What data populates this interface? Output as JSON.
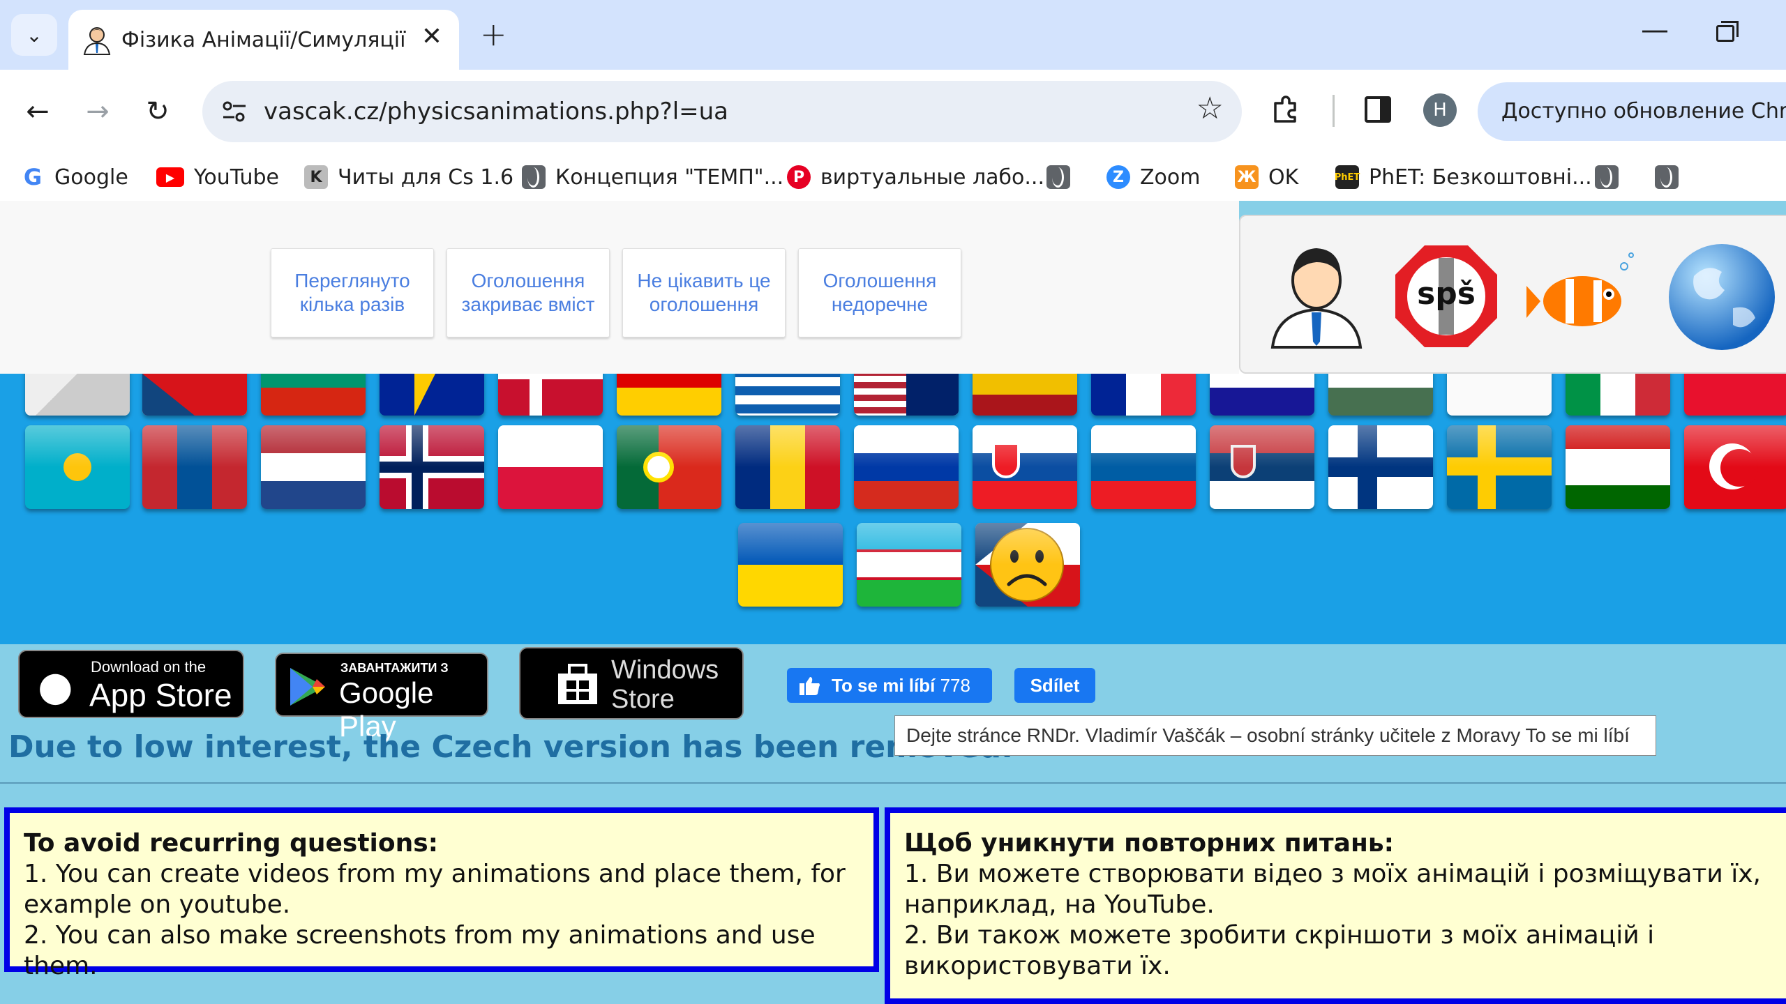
{
  "tab": {
    "title": "Фізика Анімації/Симуляції"
  },
  "toolbar": {
    "url": "vascak.cz/physicsanimations.php?l=ua",
    "update_label": "Доступно обновление Chrome",
    "profile_initial": "H"
  },
  "bookmarks": [
    {
      "label": "Google",
      "icon": "google-icon"
    },
    {
      "label": "YouTube",
      "icon": "youtube-icon"
    },
    {
      "label": "Читы для Cs 1.6",
      "icon": "cs-icon"
    },
    {
      "label": "Концепция \"ТЕМП\"...",
      "icon": "globe-icon"
    },
    {
      "label": "виртуальные лабо...",
      "icon": "pinterest-icon"
    },
    {
      "label": "",
      "icon": "globe-icon"
    },
    {
      "label": "Zoom",
      "icon": "zoom-icon"
    },
    {
      "label": "OK",
      "icon": "ok-icon"
    },
    {
      "label": "PhET: Безкоштовні...",
      "icon": "phet-icon"
    },
    {
      "label": "",
      "icon": "globe-icon"
    },
    {
      "label": "",
      "icon": "globe-icon"
    }
  ],
  "ads": {
    "buttons": [
      "Переглянуто кілька разів",
      "Оголошення закриває вміст",
      "Не цікавить це оголошення",
      "Оголошення недоречне"
    ]
  },
  "stores": {
    "apple_top": "Download on the",
    "apple_main": "App Store",
    "google_top": "ЗАВАНТАЖИТИ З",
    "google_main": "Google Play",
    "windows_top": "Windows",
    "windows_main": "Store"
  },
  "facebook": {
    "like_label": "To se mi líbí",
    "like_count": "778",
    "share_label": "Sdílet"
  },
  "tooltip": "Dejte stránce RNDr. Vladimír Vaščák – osobní stránky učitele z Moravy To se mi líbí",
  "notice": "Due to low interest, the Czech version has been removed.",
  "info_en": {
    "heading": "To avoid recurring questions:",
    "line1": "1. You can create videos from my animations and place them, for example on youtube.",
    "line2": "2. You can also make screenshots from my animations and use them."
  },
  "info_ua": {
    "heading": "Щоб уникнути повторних питань:",
    "line1": "1. Ви можете створювати відео з моїх анімацій і розміщувати їх, наприклад, на YouTube.",
    "line2": "2. Ви також можете зробити скріншоти з моїх анімацій і використовувати їх."
  },
  "colors": {
    "accent": "#1a73e8",
    "flag_bg": "#1aa0e6",
    "page_bg": "#86cfe7",
    "box_border": "#0000e6",
    "box_bg": "#ffffd2",
    "notice_text": "#1f6ea2"
  }
}
